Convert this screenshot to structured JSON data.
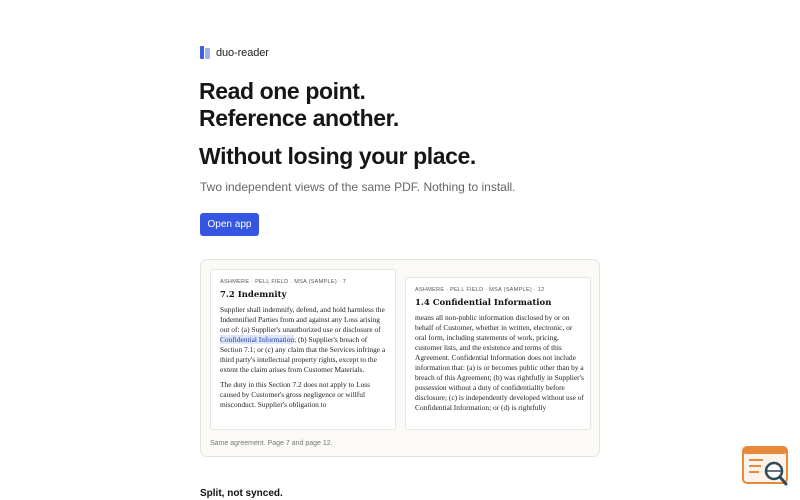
{
  "brand": {
    "name": "duo-reader"
  },
  "hero": {
    "headline_line1": "Read one point.",
    "headline_line2": "Reference another.",
    "headline2": "Without losing your place.",
    "subtitle": "Two independent views of the same PDF. Nothing to install.",
    "cta_label": "Open app"
  },
  "demo": {
    "left_page": {
      "meta": "ASHMERE · PELL FIELD · MSA (SAMPLE) · 7",
      "title": "7.2 Indemnity",
      "para1_before": "Supplier shall indemnify, defend, and hold harmless the Indemnified Parties from and against any Loss arising out of: (a) Supplier's unauthorized use or disclosure of ",
      "para1_highlight": "Confidential Information",
      "para1_after": "; (b) Supplier's breach of Section 7.1; or (c) any claim that the Services infringe a third party's intellectual property rights, except to the extent the claim arises from Customer Materials.",
      "para2": "The duty in this Section 7.2 does not apply to Loss caused by Customer's gross negligence or willful misconduct. Supplier's obligation to"
    },
    "right_page": {
      "meta": "ASHMERE · PELL FIELD · MSA (SAMPLE) · 12",
      "title": "1.4 Confidential Information",
      "para1": "means all non-public information disclosed by or on behalf of Customer, whether in written, electronic, or oral form, including statements of work, pricing, customer lists, and the existence and terms of this Agreement. Confidential Information does not include information that: (a) is or becomes public other than by a breach of this Agreement; (b) was rightfully in Supplier's possession without a duty of confidentiality before disclosure; (c) is independently developed without use of Confidential Information; or (d) is rightfully"
    },
    "caption": "Same agreement. Page 7 and page 12."
  },
  "section": {
    "heading": "Split, not synced."
  },
  "widget": {
    "icon": "search-document-icon",
    "accent": "#e8883a"
  },
  "colors": {
    "primary": "#3556e0",
    "highlight_bg": "#dde5fb"
  }
}
